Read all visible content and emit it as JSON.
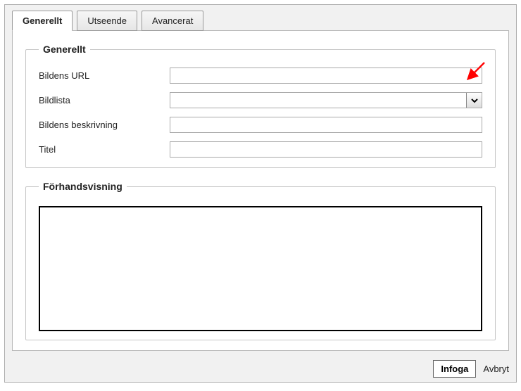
{
  "tabs": {
    "general": "Generellt",
    "appearance": "Utseende",
    "advanced": "Avancerat"
  },
  "fieldsets": {
    "general_legend": "Generellt",
    "preview_legend": "Förhandsvisning"
  },
  "labels": {
    "image_url": "Bildens URL",
    "image_list": "Bildlista",
    "image_desc": "Bildens beskrivning",
    "title": "Titel"
  },
  "values": {
    "image_url": "",
    "image_list_selected": "",
    "image_desc": "",
    "title": ""
  },
  "buttons": {
    "insert": "Infoga",
    "cancel": "Avbryt"
  }
}
